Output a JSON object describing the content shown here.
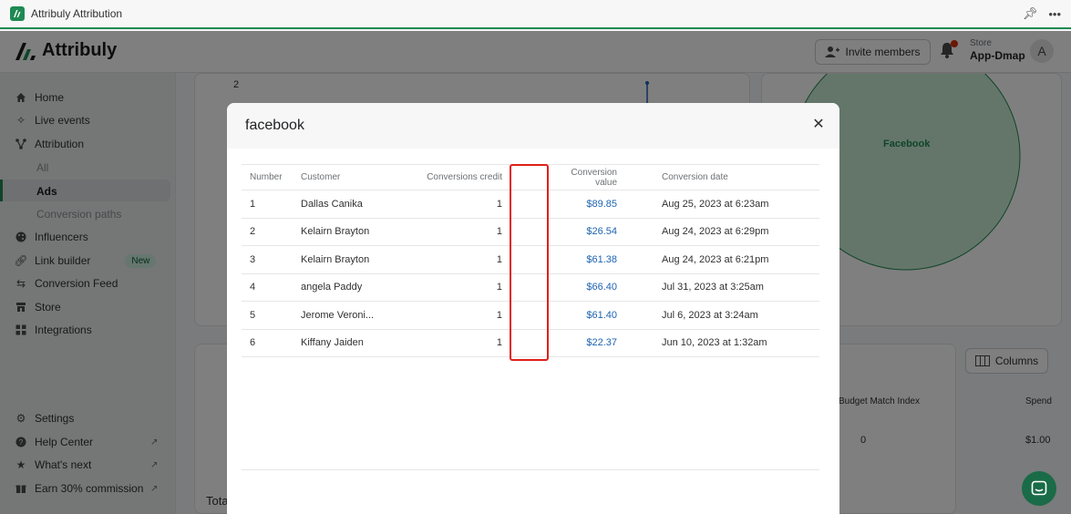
{
  "window": {
    "title": "Attribuly Attribution"
  },
  "brand": {
    "name": "Attribuly"
  },
  "header": {
    "invite_label": "Invite members",
    "store_label": "Store",
    "store_name": "App-Dmap",
    "avatar_letter": "A"
  },
  "sidebar": {
    "items": [
      {
        "label": "Home",
        "icon": "home-icon"
      },
      {
        "label": "Live events",
        "icon": "sparkle-icon"
      },
      {
        "label": "Attribution",
        "icon": "attribution-icon"
      },
      {
        "label": "All"
      },
      {
        "label": "Ads"
      },
      {
        "label": "Conversion paths"
      },
      {
        "label": "Influencers",
        "icon": "palette-icon"
      },
      {
        "label": "Link builder",
        "icon": "link-icon",
        "badge": "New"
      },
      {
        "label": "Conversion Feed",
        "icon": "arrows-icon"
      },
      {
        "label": "Store",
        "icon": "store-icon"
      },
      {
        "label": "Integrations",
        "icon": "apps-icon"
      }
    ],
    "bottom_items": [
      {
        "label": "Settings",
        "icon": "gear-icon"
      },
      {
        "label": "Help Center",
        "icon": "help-icon"
      },
      {
        "label": "What's next",
        "icon": "star-icon"
      },
      {
        "label": "Earn 30% commission",
        "icon": "gift-icon"
      }
    ]
  },
  "background": {
    "chart_tick": "2",
    "bubble_label": "Facebook",
    "columns_label": "Columns",
    "budget_header": "Budget Match Index",
    "spend_header": "Spend",
    "row_value": "0",
    "row_spend": "$1.00",
    "total_label": "Tota"
  },
  "modal": {
    "title": "facebook",
    "columns": [
      "Number",
      "Customer",
      "Conversions credit",
      "",
      "Conversion value",
      "Conversion date"
    ],
    "rows": [
      {
        "number": "1",
        "customer": "Dallas Canika",
        "credit": "1",
        "value": "$89.85",
        "date": "Aug 25, 2023 at 6:23am"
      },
      {
        "number": "2",
        "customer": "Kelairn Brayton",
        "credit": "1",
        "value": "$26.54",
        "date": "Aug 24, 2023 at 6:29pm"
      },
      {
        "number": "3",
        "customer": "Kelairn Brayton",
        "credit": "1",
        "value": "$61.38",
        "date": "Aug 24, 2023 at 6:21pm"
      },
      {
        "number": "4",
        "customer": "angela Paddy",
        "credit": "1",
        "value": "$66.40",
        "date": "Jul 31, 2023 at 3:25am"
      },
      {
        "number": "5",
        "customer": "Jerome Veroni...",
        "credit": "1",
        "value": "$61.40",
        "date": "Jul 6, 2023 at 3:24am"
      },
      {
        "number": "6",
        "customer": "Kiffany Jaiden",
        "credit": "1",
        "value": "$22.37",
        "date": "Jun 10, 2023 at 1:32am"
      }
    ]
  },
  "colors": {
    "accent": "#1f8a52",
    "link": "#1e63b2",
    "highlight": "#e0201b"
  }
}
